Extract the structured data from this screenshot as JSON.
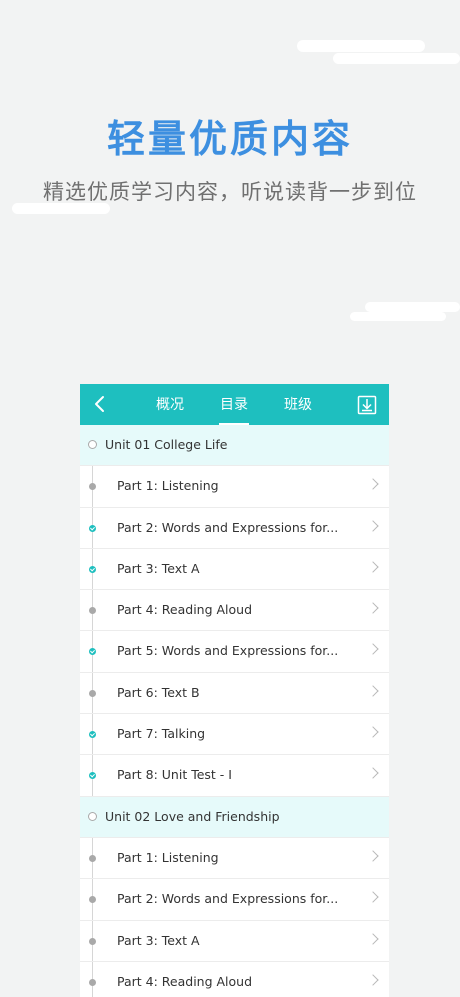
{
  "hero": {
    "title": "轻量优质内容",
    "subtitle": "精选优质学习内容，听说读背一步到位"
  },
  "navbar": {
    "tabs": [
      {
        "label": "概况"
      },
      {
        "label": "目录",
        "active": true
      },
      {
        "label": "班级"
      }
    ]
  },
  "units": [
    {
      "title": "Unit 01 College Life",
      "parts": [
        {
          "label": "Part 1: Listening",
          "completed": false
        },
        {
          "label": "Part 2: Words and Expressions for...",
          "completed": true
        },
        {
          "label": "Part 3: Text A",
          "completed": true
        },
        {
          "label": "Part 4: Reading Aloud",
          "completed": false
        },
        {
          "label": "Part 5: Words and Expressions for...",
          "completed": true
        },
        {
          "label": "Part 6: Text B",
          "completed": false
        },
        {
          "label": "Part 7: Talking",
          "completed": true
        },
        {
          "label": "Part 8: Unit Test - I",
          "completed": true
        }
      ]
    },
    {
      "title": "Unit 02 Love and Friendship",
      "parts": [
        {
          "label": "Part 1: Listening",
          "completed": false
        },
        {
          "label": "Part 2: Words and Expressions for...",
          "completed": false
        },
        {
          "label": "Part 3: Text A",
          "completed": false
        },
        {
          "label": "Part 4: Reading Aloud",
          "completed": false
        }
      ]
    }
  ],
  "colors": {
    "accent": "#1ebfbf",
    "title_blue": "#3d8fe0",
    "unit_bg": "#e6fafa"
  },
  "icons": [
    "back-icon",
    "download-icon",
    "chevron-right-icon"
  ]
}
